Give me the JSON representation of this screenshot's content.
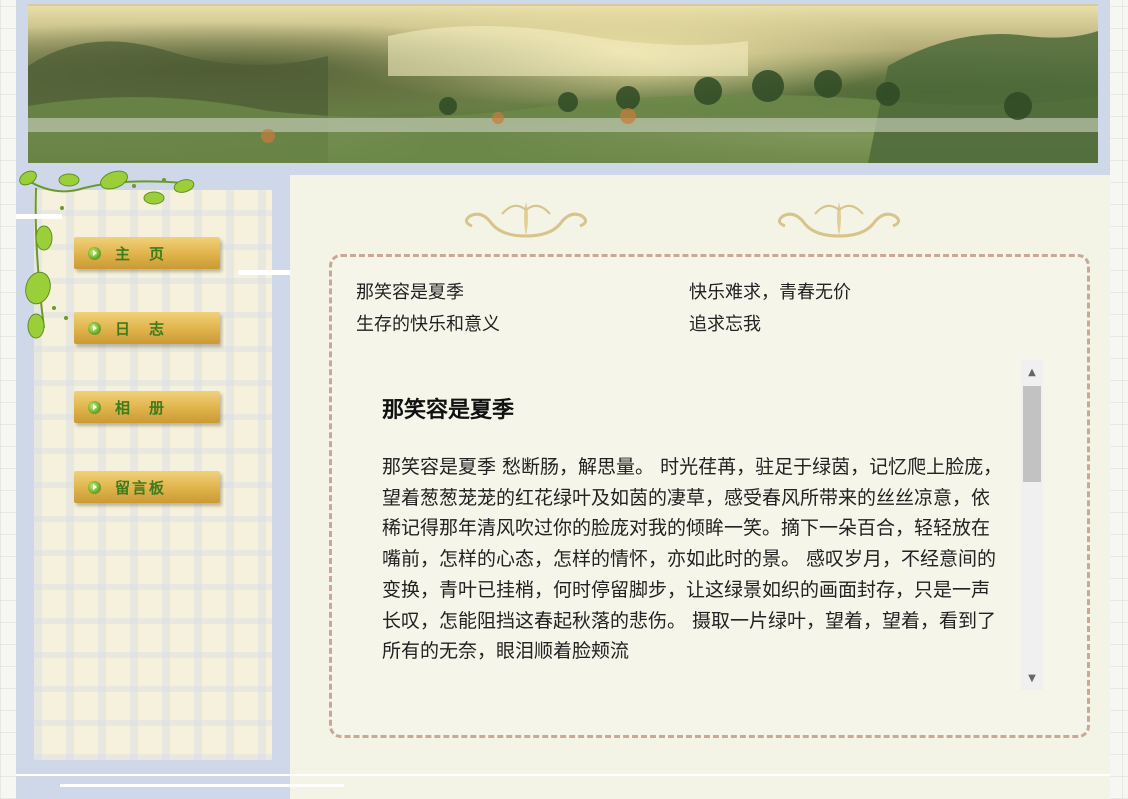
{
  "banner": {
    "description_icon": "landscape-painting"
  },
  "nav": {
    "items": [
      {
        "label": "主　页"
      },
      {
        "label": "日　志"
      },
      {
        "label": "相　册"
      },
      {
        "label": "留言板"
      }
    ]
  },
  "links": [
    "那笑容是夏季",
    "快乐难求，青春无价",
    "生存的快乐和意义",
    "追求忘我"
  ],
  "article": {
    "title": "那笑容是夏季",
    "body": "那笑容是夏季 愁断肠，解思量。 时光荏苒，驻足于绿茵，记忆爬上脸庞，望着葱葱茏茏的红花绿叶及如茵的凄草，感受春风所带来的丝丝凉意，依稀记得那年清风吹过你的脸庞对我的倾眸一笑。摘下一朵百合，轻轻放在嘴前，怎样的心态，怎样的情怀，亦如此时的景。 感叹岁月，不经意间的变换，青叶已挂梢，何时停留脚步，让这绿景如织的画面封存，只是一声长叹，怎能阻挡这春起秋落的悲伤。 摄取一片绿叶，望着，望着，看到了所有的无奈，眼泪顺着脸颊流"
  },
  "colors": {
    "frame": "#cfd8e8",
    "nav_button": "#e0b24a",
    "nav_text": "#3d7c1c",
    "box_border": "#c9a898"
  }
}
